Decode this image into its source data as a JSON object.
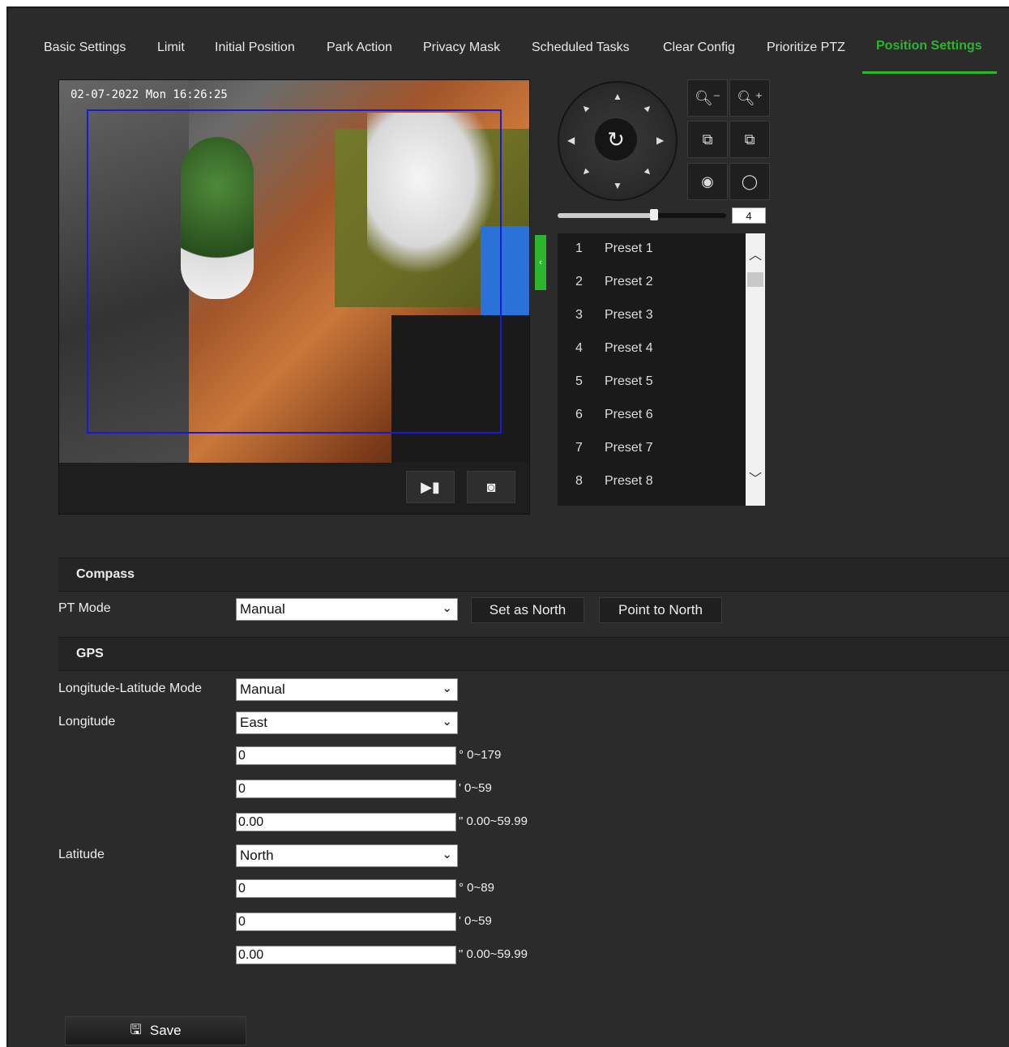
{
  "tabs": [
    {
      "label": "Basic Settings"
    },
    {
      "label": "Limit"
    },
    {
      "label": "Initial Position"
    },
    {
      "label": "Park Action"
    },
    {
      "label": "Privacy Mask"
    },
    {
      "label": "Scheduled Tasks"
    },
    {
      "label": "Clear Config"
    },
    {
      "label": "Prioritize PTZ"
    },
    {
      "label": "Position Settings",
      "active": true
    }
  ],
  "video": {
    "osd": "02-07-2022 Mon 16:26:25",
    "record_icon": "record-video-icon",
    "snapshot_icon": "camera-icon"
  },
  "ptz": {
    "center_icon": "refresh-icon",
    "buttons": [
      "zoom-out-icon",
      "zoom-in-icon",
      "focus-near-icon",
      "focus-far-icon",
      "iris-close-icon",
      "iris-open-icon"
    ],
    "speed": {
      "value": "4",
      "level": 4,
      "max": 7
    }
  },
  "presets": [
    {
      "num": "1",
      "name": "Preset 1"
    },
    {
      "num": "2",
      "name": "Preset 2"
    },
    {
      "num": "3",
      "name": "Preset 3"
    },
    {
      "num": "4",
      "name": "Preset 4"
    },
    {
      "num": "5",
      "name": "Preset 5"
    },
    {
      "num": "6",
      "name": "Preset 6"
    },
    {
      "num": "7",
      "name": "Preset 7"
    },
    {
      "num": "8",
      "name": "Preset 8"
    }
  ],
  "compass": {
    "title": "Compass",
    "pt_mode_label": "PT Mode",
    "pt_mode_value": "Manual",
    "set_north": "Set as North",
    "point_north": "Point to North"
  },
  "gps": {
    "title": "GPS",
    "mode_label": "Longitude-Latitude Mode",
    "mode_value": "Manual",
    "longitude_label": "Longitude",
    "longitude_dir": "East",
    "lon_deg": "0",
    "lon_deg_unit": "° 0~179",
    "lon_min": "0",
    "lon_min_unit": "' 0~59",
    "lon_sec": "0.00",
    "lon_sec_unit": "\" 0.00~59.99",
    "latitude_label": "Latitude",
    "latitude_dir": "North",
    "lat_deg": "0",
    "lat_deg_unit": "° 0~89",
    "lat_min": "0",
    "lat_min_unit": "' 0~59",
    "lat_sec": "0.00",
    "lat_sec_unit": "\" 0.00~59.99"
  },
  "save_label": "Save",
  "colors": {
    "accent": "#2db52d",
    "background": "#2b2b2b",
    "roi": "#1a1ad6"
  }
}
